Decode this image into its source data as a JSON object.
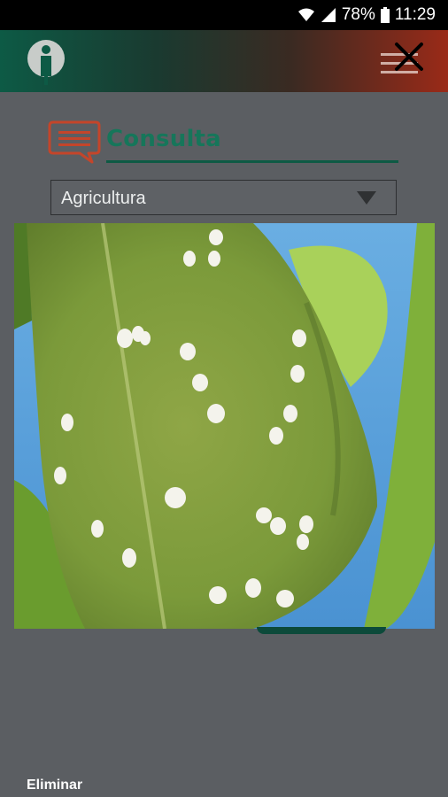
{
  "status_bar": {
    "battery": "78%",
    "time": "11:29",
    "icons": [
      "wifi-icon",
      "signal-icon",
      "battery-icon"
    ]
  },
  "app_bar": {
    "logo_icon": "info-person-icon",
    "menu_icon": "hamburger-close-icon"
  },
  "form": {
    "title": "Consulta",
    "title_icon": "chat-bubble-icon",
    "category_select": {
      "selected": "Agricultura"
    },
    "photo_icon": "leaf-with-whiteflies-photo"
  },
  "actions": {
    "delete_label": "Eliminar"
  },
  "colors": {
    "accent": "#16765a",
    "appbar_start": "#0d5a45",
    "appbar_end": "#9a2a18",
    "icon_orange": "#c4452a",
    "background": "#5b5e62"
  }
}
